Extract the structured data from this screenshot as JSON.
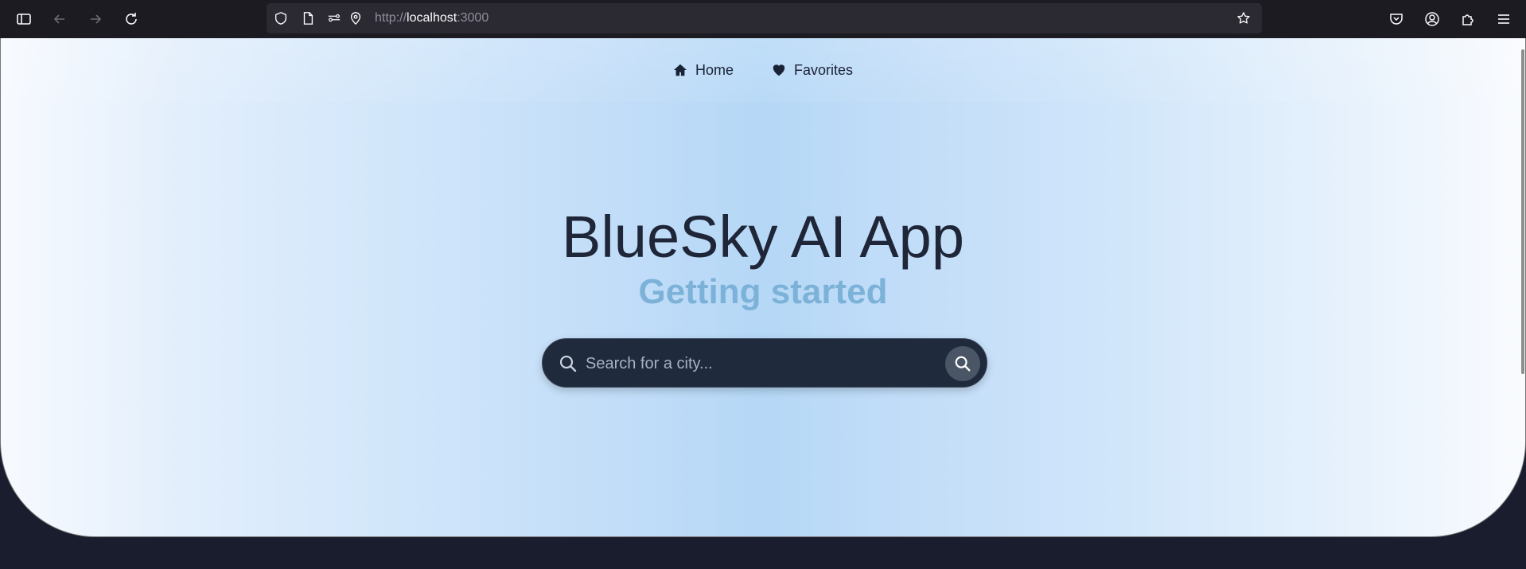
{
  "browser": {
    "url_scheme": "http://",
    "url_host": "localhost",
    "url_port": ":3000"
  },
  "icons": {
    "sidebar": "sidebar-icon",
    "back": "arrow-left-icon",
    "forward": "arrow-right-icon",
    "reload": "reload-icon",
    "shield": "shield-icon",
    "page": "page-icon",
    "permissions": "permissions-icon",
    "location": "location-pin-icon",
    "bookmark": "star-icon",
    "pocket": "pocket-icon",
    "account": "account-icon",
    "extensions": "puzzle-icon",
    "menu": "hamburger-menu-icon"
  },
  "nav": {
    "items": [
      {
        "label": "Home",
        "icon": "home-icon"
      },
      {
        "label": "Favorites",
        "icon": "heart-icon"
      }
    ]
  },
  "hero": {
    "title": "BlueSky AI App",
    "subtitle": "Getting started"
  },
  "search": {
    "placeholder": "Search for a city..."
  },
  "colors": {
    "title": "#1e2638",
    "subtitle": "#7db2d8",
    "search_bg": "#1f2a3c",
    "page_bg_dark": "#1a1d2e"
  }
}
